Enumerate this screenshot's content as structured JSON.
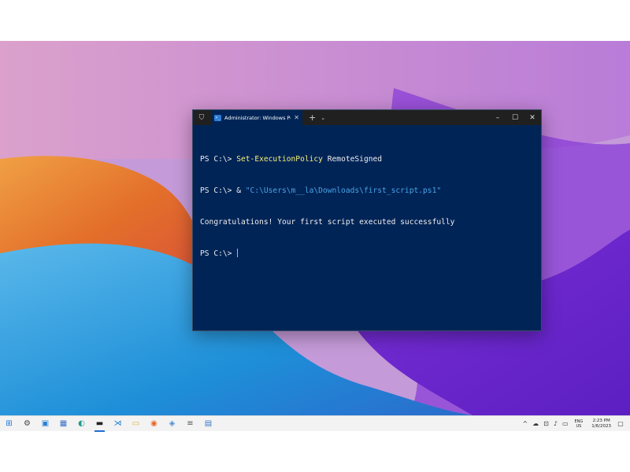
{
  "terminal": {
    "tab_title": "Administrator: Windows Powe",
    "tab_icon_text": ">_",
    "new_tab_symbol": "+",
    "dropdown_symbol": "⌄",
    "minimize_symbol": "–",
    "maximize_symbol": "☐",
    "close_symbol": "✕",
    "tab_close_symbol": "✕",
    "lines": [
      {
        "prompt": "PS C:\\> ",
        "cmd": "Set-ExecutionPolicy",
        "rest": " RemoteSigned",
        "string": ""
      },
      {
        "prompt": "PS C:\\> & ",
        "cmd": "",
        "rest": "",
        "string": "\"C:\\Users\\m__la\\Downloads\\first_script.ps1\""
      },
      {
        "prompt": "Congratulations! Your first script executed successfully",
        "cmd": "",
        "rest": "",
        "string": ""
      },
      {
        "prompt": "PS C:\\> ",
        "cmd": "",
        "rest": "",
        "string": ""
      }
    ],
    "colors": {
      "background": "#012456",
      "command": "#f5f07a",
      "string": "#4aa3e8",
      "text": "#eeedf0"
    }
  },
  "taskbar": {
    "icons": [
      {
        "name": "start-icon",
        "glyph": "⊞"
      },
      {
        "name": "settings-icon",
        "glyph": "⚙"
      },
      {
        "name": "app-icon",
        "glyph": "▣"
      },
      {
        "name": "store-icon",
        "glyph": "▦"
      },
      {
        "name": "edge-icon",
        "glyph": "◐"
      },
      {
        "name": "terminal-icon",
        "glyph": "▬"
      },
      {
        "name": "vscode-icon",
        "glyph": "⋊"
      },
      {
        "name": "file-explorer-icon",
        "glyph": "▭"
      },
      {
        "name": "firefox-icon",
        "glyph": "◉"
      },
      {
        "name": "app2-icon",
        "glyph": "◈"
      },
      {
        "name": "app3-icon",
        "glyph": "≡"
      },
      {
        "name": "app4-icon",
        "glyph": "▤"
      }
    ],
    "tray": {
      "chevron": "^",
      "lang_top": "ENG",
      "lang_bottom": "US",
      "time": "2:23 PM",
      "date": "1/6/2023"
    }
  }
}
